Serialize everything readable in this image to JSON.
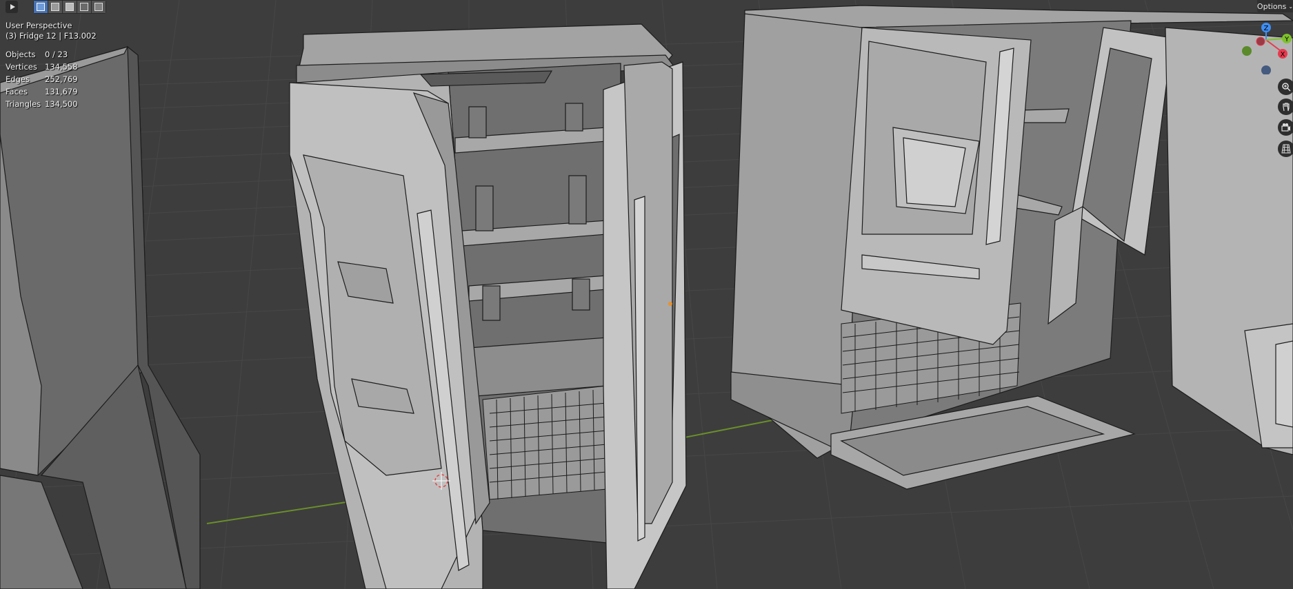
{
  "header": {
    "options_label": "Options"
  },
  "viewport": {
    "title": "User Perspective",
    "object_context": "(3) Fridge 12 | F13.002"
  },
  "stats": [
    {
      "label": "Objects",
      "value": "0 / 23"
    },
    {
      "label": "Vertices",
      "value": "134,558"
    },
    {
      "label": "Edges",
      "value": "252,769"
    },
    {
      "label": "Faces",
      "value": "131,679"
    },
    {
      "label": "Triangles",
      "value": "134,500"
    }
  ],
  "gizmo": {
    "axes": {
      "z": "Z",
      "y": "Y",
      "x": "X"
    },
    "colors": {
      "x": "#e8394e",
      "y": "#7ec22c",
      "z": "#3f8ef4",
      "neg_y": "#5a8a2a",
      "neg_x": "#9b3a44",
      "neg_z": "#445a7e"
    }
  },
  "nav": {
    "buttons": [
      "zoom-icon",
      "hand-pan-icon",
      "camera-icon",
      "grid-icon"
    ]
  },
  "toolbar": {
    "tools": [
      "select-cursor-icon"
    ],
    "selection_modes": [
      "select-new-icon",
      "select-extend-icon",
      "select-subtract-icon",
      "select-invert-icon",
      "select-intersect-icon"
    ]
  },
  "colors": {
    "background": "#3d3d3d",
    "grid": "#4a4a4a",
    "x_axis_line": "#6a8f2a",
    "active_mode": "#4772b3",
    "model_face": "#9d9d9d",
    "model_edge": "#1c1c1c"
  }
}
